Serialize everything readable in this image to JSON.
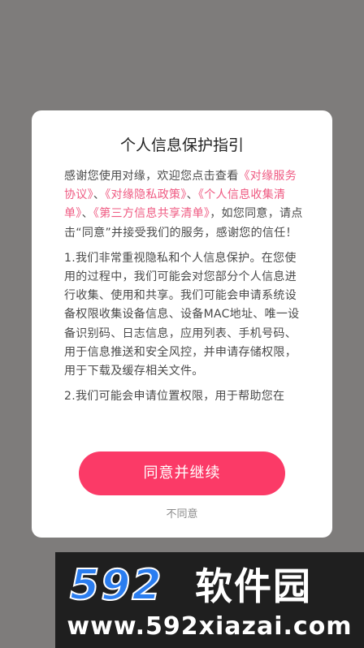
{
  "dialog": {
    "title": "个人信息保护指引",
    "intro": {
      "prefix": "感谢您使用对缘，欢迎您点击查看",
      "link1": "《对缘服务协议》",
      "sep1": "、",
      "link2": "《对缘隐私政策》",
      "sep2": "、",
      "link3": "《个人信息收集清单》",
      "sep3": "、",
      "link4": "《第三方信息共享清单》",
      "suffix": "，如您同意，请点击“同意”并接受我们的服务，感谢您的信任！"
    },
    "para1": "1.我们非常重视隐私和个人信息保护。在您使用的过程中，我们可能会对您部分个人信息进行收集、使用和共享。我们可能会申请系统设备权限收集设备信息、设备MAC地址、唯一设备识别码、日志信息，应用列表、手机号码、用于信息推送和安全风控，并申请存储权限，用于下载及缓存相关文件。",
    "para2": "2.我们可能会申请位置权限，用于帮助您在",
    "agree_label": "同意并继续",
    "disagree_label": "不同意"
  },
  "watermark": {
    "brand": "592软件园",
    "url": "www.592xiazai.com"
  },
  "colors": {
    "overlay": "#7e7c7b",
    "accent": "#fb3a67",
    "link": "#ef5a82",
    "logo_blue": "#2a7df0"
  }
}
